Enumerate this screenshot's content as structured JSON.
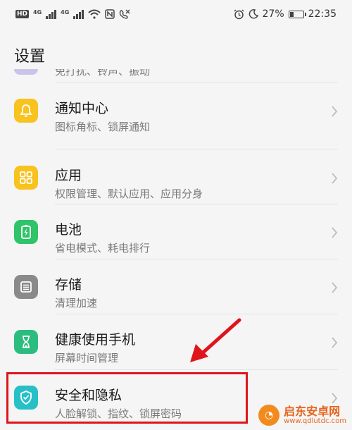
{
  "status_bar": {
    "hd": "HD",
    "network1": "4G",
    "network2": "4G",
    "battery": "27%",
    "time": "22:35"
  },
  "header": {
    "title": "设置"
  },
  "partial_item": {
    "subtitle": "免打扰、铃声、振动"
  },
  "items": [
    {
      "title": "通知中心",
      "subtitle": "图标角标、锁屏通知",
      "icon": "bell-icon",
      "color": "#f8c21f"
    },
    {
      "title": "应用",
      "subtitle": "权限管理、默认应用、应用分身",
      "icon": "apps-grid-icon",
      "color": "#f8c21f"
    },
    {
      "title": "电池",
      "subtitle": "省电模式、耗电排行",
      "icon": "battery-icon",
      "color": "#2fc36a"
    },
    {
      "title": "存储",
      "subtitle": "清理加速",
      "icon": "storage-icon",
      "color": "#8a8a8a"
    },
    {
      "title": "健康使用手机",
      "subtitle": "屏幕时间管理",
      "icon": "hourglass-icon",
      "color": "#2bbd7e"
    },
    {
      "title": "安全和隐私",
      "subtitle": "人脸解锁、指纹、锁屏密码",
      "icon": "shield-check-icon",
      "color": "#27c0c7"
    }
  ],
  "watermark": {
    "name": "启东安卓网",
    "url": "www.qdlutdc.com"
  },
  "colors": {
    "highlight": "#e0141b",
    "accent_yellow": "#f8c21f",
    "accent_green": "#2fc36a",
    "accent_teal": "#27c0c7"
  }
}
